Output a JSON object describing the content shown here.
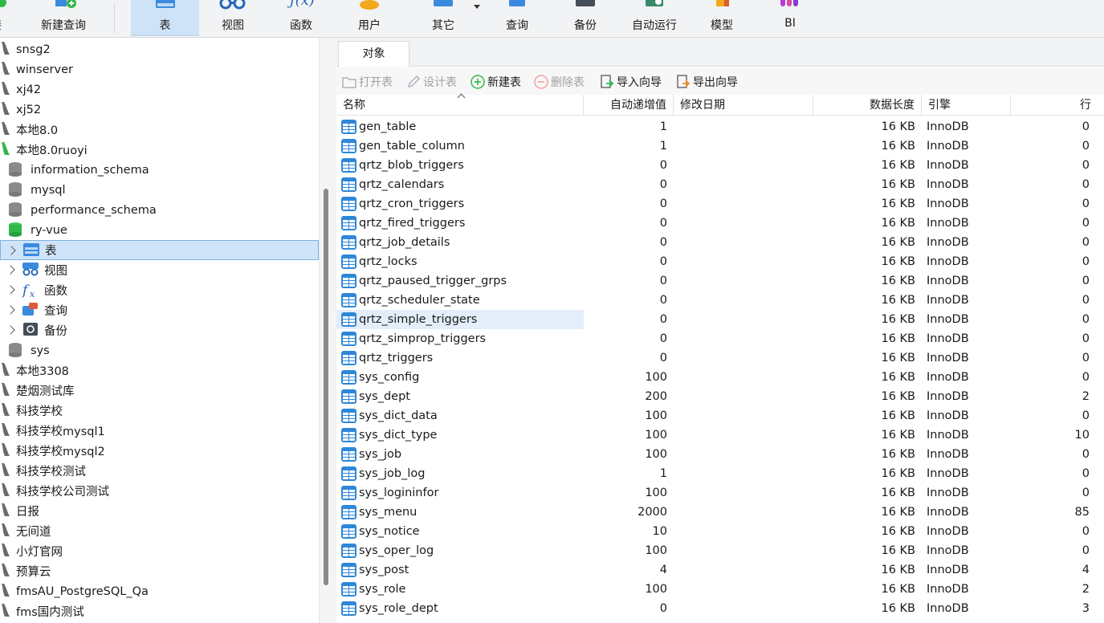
{
  "toolbar": {
    "items": [
      {
        "label": "接"
      },
      {
        "label": "新建查询"
      },
      {
        "label": "表"
      },
      {
        "label": "视图"
      },
      {
        "label": "函数"
      },
      {
        "label": "用户"
      },
      {
        "label": "其它"
      },
      {
        "label": "查询"
      },
      {
        "label": "备份"
      },
      {
        "label": "自动运行"
      },
      {
        "label": "模型"
      },
      {
        "label": "BI"
      }
    ],
    "active": "表"
  },
  "tree": {
    "items": [
      {
        "label": "snsg2",
        "kind": "conn"
      },
      {
        "label": "winserver",
        "kind": "conn"
      },
      {
        "label": "xj42",
        "kind": "conn"
      },
      {
        "label": "xj52",
        "kind": "conn"
      },
      {
        "label": "本地8.0",
        "kind": "conn"
      },
      {
        "label": "本地8.0ruoyi",
        "kind": "conn-open"
      },
      {
        "label": "information_schema",
        "kind": "db"
      },
      {
        "label": "mysql",
        "kind": "db"
      },
      {
        "label": "performance_schema",
        "kind": "db"
      },
      {
        "label": "ry-vue",
        "kind": "db-open"
      },
      {
        "label": "表",
        "kind": "tables"
      },
      {
        "label": "视图",
        "kind": "views"
      },
      {
        "label": "函数",
        "kind": "functions"
      },
      {
        "label": "查询",
        "kind": "queries"
      },
      {
        "label": "备份",
        "kind": "backups"
      },
      {
        "label": "sys",
        "kind": "db"
      },
      {
        "label": "本地3308",
        "kind": "conn"
      },
      {
        "label": "楚烟测试库",
        "kind": "conn"
      },
      {
        "label": "科技学校",
        "kind": "conn"
      },
      {
        "label": "科技学校mysql1",
        "kind": "conn"
      },
      {
        "label": "科技学校mysql2",
        "kind": "conn"
      },
      {
        "label": "科技学校测试",
        "kind": "conn"
      },
      {
        "label": "科技学校公司测试",
        "kind": "conn"
      },
      {
        "label": "日报",
        "kind": "conn"
      },
      {
        "label": "无间道",
        "kind": "conn"
      },
      {
        "label": "小灯官网",
        "kind": "conn"
      },
      {
        "label": "预算云",
        "kind": "conn"
      },
      {
        "label": "fmsAU_PostgreSQL_Qa",
        "kind": "pg"
      },
      {
        "label": "fms国内测试",
        "kind": "pg"
      }
    ]
  },
  "tab": {
    "label": "对象"
  },
  "actions": [
    {
      "label": "打开表",
      "disabled": true,
      "icon": "folder-icon"
    },
    {
      "label": "设计表",
      "disabled": true,
      "icon": "pencil-icon"
    },
    {
      "label": "新建表",
      "disabled": false,
      "icon": "plus-circle-icon"
    },
    {
      "label": "删除表",
      "disabled": true,
      "icon": "minus-circle-icon"
    },
    {
      "label": "导入向导",
      "disabled": false,
      "icon": "import-icon"
    },
    {
      "label": "导出向导",
      "disabled": false,
      "icon": "export-icon"
    }
  ],
  "columns": [
    "名称",
    "自动递增值",
    "修改日期",
    "数据长度",
    "引擎",
    "行"
  ],
  "rows": [
    {
      "name": "gen_table",
      "auto_inc": "1",
      "modified": "",
      "size": "16 KB",
      "engine": "InnoDB",
      "rows": "0"
    },
    {
      "name": "gen_table_column",
      "auto_inc": "1",
      "modified": "",
      "size": "16 KB",
      "engine": "InnoDB",
      "rows": "0"
    },
    {
      "name": "qrtz_blob_triggers",
      "auto_inc": "0",
      "modified": "",
      "size": "16 KB",
      "engine": "InnoDB",
      "rows": "0"
    },
    {
      "name": "qrtz_calendars",
      "auto_inc": "0",
      "modified": "",
      "size": "16 KB",
      "engine": "InnoDB",
      "rows": "0"
    },
    {
      "name": "qrtz_cron_triggers",
      "auto_inc": "0",
      "modified": "",
      "size": "16 KB",
      "engine": "InnoDB",
      "rows": "0"
    },
    {
      "name": "qrtz_fired_triggers",
      "auto_inc": "0",
      "modified": "",
      "size": "16 KB",
      "engine": "InnoDB",
      "rows": "0"
    },
    {
      "name": "qrtz_job_details",
      "auto_inc": "0",
      "modified": "",
      "size": "16 KB",
      "engine": "InnoDB",
      "rows": "0"
    },
    {
      "name": "qrtz_locks",
      "auto_inc": "0",
      "modified": "",
      "size": "16 KB",
      "engine": "InnoDB",
      "rows": "0"
    },
    {
      "name": "qrtz_paused_trigger_grps",
      "auto_inc": "0",
      "modified": "",
      "size": "16 KB",
      "engine": "InnoDB",
      "rows": "0"
    },
    {
      "name": "qrtz_scheduler_state",
      "auto_inc": "0",
      "modified": "",
      "size": "16 KB",
      "engine": "InnoDB",
      "rows": "0"
    },
    {
      "name": "qrtz_simple_triggers",
      "auto_inc": "0",
      "modified": "",
      "size": "16 KB",
      "engine": "InnoDB",
      "rows": "0",
      "hover": true
    },
    {
      "name": "qrtz_simprop_triggers",
      "auto_inc": "0",
      "modified": "",
      "size": "16 KB",
      "engine": "InnoDB",
      "rows": "0"
    },
    {
      "name": "qrtz_triggers",
      "auto_inc": "0",
      "modified": "",
      "size": "16 KB",
      "engine": "InnoDB",
      "rows": "0"
    },
    {
      "name": "sys_config",
      "auto_inc": "100",
      "modified": "",
      "size": "16 KB",
      "engine": "InnoDB",
      "rows": "0"
    },
    {
      "name": "sys_dept",
      "auto_inc": "200",
      "modified": "",
      "size": "16 KB",
      "engine": "InnoDB",
      "rows": "2"
    },
    {
      "name": "sys_dict_data",
      "auto_inc": "100",
      "modified": "",
      "size": "16 KB",
      "engine": "InnoDB",
      "rows": "0"
    },
    {
      "name": "sys_dict_type",
      "auto_inc": "100",
      "modified": "",
      "size": "16 KB",
      "engine": "InnoDB",
      "rows": "10"
    },
    {
      "name": "sys_job",
      "auto_inc": "100",
      "modified": "",
      "size": "16 KB",
      "engine": "InnoDB",
      "rows": "0"
    },
    {
      "name": "sys_job_log",
      "auto_inc": "1",
      "modified": "",
      "size": "16 KB",
      "engine": "InnoDB",
      "rows": "0"
    },
    {
      "name": "sys_logininfor",
      "auto_inc": "100",
      "modified": "",
      "size": "16 KB",
      "engine": "InnoDB",
      "rows": "0"
    },
    {
      "name": "sys_menu",
      "auto_inc": "2000",
      "modified": "",
      "size": "16 KB",
      "engine": "InnoDB",
      "rows": "85"
    },
    {
      "name": "sys_notice",
      "auto_inc": "10",
      "modified": "",
      "size": "16 KB",
      "engine": "InnoDB",
      "rows": "0"
    },
    {
      "name": "sys_oper_log",
      "auto_inc": "100",
      "modified": "",
      "size": "16 KB",
      "engine": "InnoDB",
      "rows": "0"
    },
    {
      "name": "sys_post",
      "auto_inc": "4",
      "modified": "",
      "size": "16 KB",
      "engine": "InnoDB",
      "rows": "4"
    },
    {
      "name": "sys_role",
      "auto_inc": "100",
      "modified": "",
      "size": "16 KB",
      "engine": "InnoDB",
      "rows": "2"
    },
    {
      "name": "sys_role_dept",
      "auto_inc": "0",
      "modified": "",
      "size": "16 KB",
      "engine": "InnoDB",
      "rows": "3"
    }
  ],
  "colors": {
    "accent": "#2f87d8",
    "selected_bg": "#cfe4f8",
    "toolbar_bg": "#f2f3f5",
    "db_green": "#2fb84a"
  }
}
